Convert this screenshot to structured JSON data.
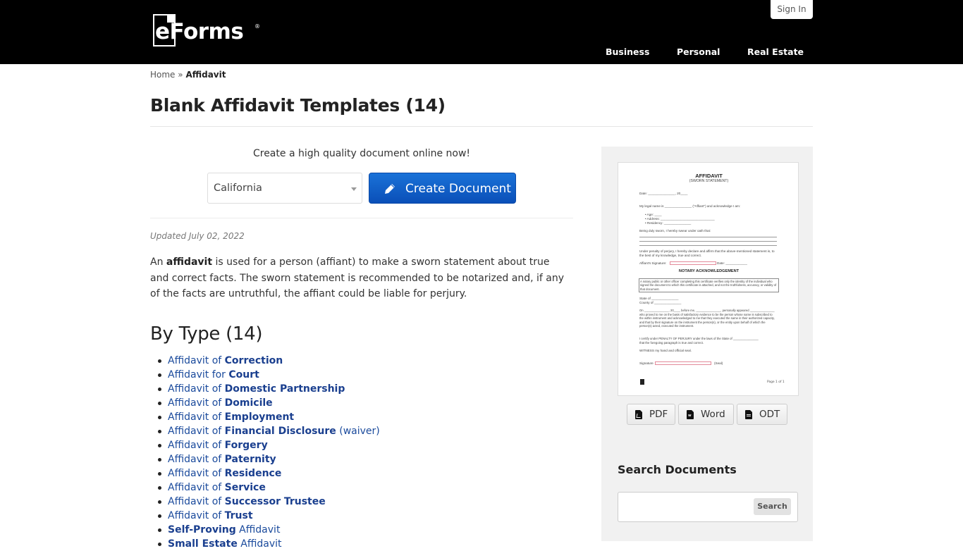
{
  "header": {
    "logo_text": "eForms",
    "logo_reg": "®",
    "sign_in": "Sign In",
    "nav": [
      "Business",
      "Personal",
      "Real Estate"
    ]
  },
  "breadcrumb": {
    "home": "Home",
    "separator": "»",
    "current": "Affidavit"
  },
  "page_title": "Blank Affidavit Templates (14)",
  "cta": {
    "text": "Create a high quality document online now!",
    "state_selected": "California",
    "create_button": "Create Document"
  },
  "updated": "Updated July 02, 2022",
  "intro": {
    "prefix": "An ",
    "bold": "affidavit",
    "rest": " is used for a person (affiant) to make a sworn statement about true and correct facts. The sworn statement is recommended to be notarized and, if any of the facts are untruthful, the affiant could be liable for perjury."
  },
  "by_type": {
    "heading": "By Type (14)",
    "items": [
      {
        "pre": "Affidavit of ",
        "bold": "Correction",
        "post": ""
      },
      {
        "pre": "Affidavit for ",
        "bold": "Court",
        "post": ""
      },
      {
        "pre": "Affidavit of ",
        "bold": "Domestic Partnership",
        "post": ""
      },
      {
        "pre": "Affidavit of ",
        "bold": "Domicile",
        "post": ""
      },
      {
        "pre": "Affidavit of ",
        "bold": "Employment",
        "post": ""
      },
      {
        "pre": "Affidavit of ",
        "bold": "Financial Disclosure",
        "post": " (waiver)"
      },
      {
        "pre": "Affidavit of ",
        "bold": "Forgery",
        "post": ""
      },
      {
        "pre": "Affidavit of ",
        "bold": "Paternity",
        "post": ""
      },
      {
        "pre": "Affidavit of ",
        "bold": "Residence",
        "post": ""
      },
      {
        "pre": "Affidavit of ",
        "bold": "Service",
        "post": ""
      },
      {
        "pre": "Affidavit of ",
        "bold": "Successor Trustee",
        "post": ""
      },
      {
        "pre": "Affidavit of ",
        "bold": "Trust",
        "post": ""
      },
      {
        "pre": "",
        "bold": "Self-Proving",
        "post": " Affidavit"
      },
      {
        "pre": "",
        "bold": "Small Estate",
        "post": " Affidavit"
      }
    ]
  },
  "sidebar": {
    "preview": {
      "title": "AFFIDAVIT",
      "subtitle": "(SWORN STATEMENT)",
      "date_line": "Date: _______________, 20____",
      "legal_name": "My legal name is _______________ (\"Affiant\") and acknowledge I am:",
      "bullets": [
        "Age: ____",
        "Address: ______________________________",
        "Residency: _______________"
      ],
      "sworn": "Being duly sworn, I hereby swear under oath that:",
      "penalty": "Under penalty of perjury, I hereby declare and affirm that the above-mentioned statement is, to the best of my knowledge, true and correct.",
      "affiant_sig": "Affiant's Signature:",
      "date_label": "Date: ____________",
      "notary_heading": "NOTARY ACKNOWLEDGEMENT",
      "notary_box": "A notary public or other officer completing this certificate verifies only the identity of the individual who signed the document to which this certificate is attached, and not the truthfulness, accuracy, or validity of that document.",
      "state_of": "State of _______________",
      "county_of": "County of _______________",
      "on_para": "On _______________, 20____ before me, _______________, personally appeared _______________ who proved to me on the basis of satisfactory evidence to be the person whose name is subscribed to the within instrument and acknowledged to me that they executed the same in their authorized capacity, and that by their signature on the instrument the person(s), or the entity upon behalf of which the person(s) acted, executed the instrument.",
      "certify": "I certify under PENALTY OF PERJURY under the laws of the State of _______________ that the foregoing paragraph is true and correct.",
      "witness": "WITNESS my hand and official seal.",
      "signature": "Signature",
      "seal": "(Seal)",
      "page": "Page 1 of 1"
    },
    "downloads": [
      "PDF",
      "Word",
      "ODT"
    ],
    "search_heading": "Search Documents",
    "search_placeholder": "",
    "search_button": "Search"
  }
}
